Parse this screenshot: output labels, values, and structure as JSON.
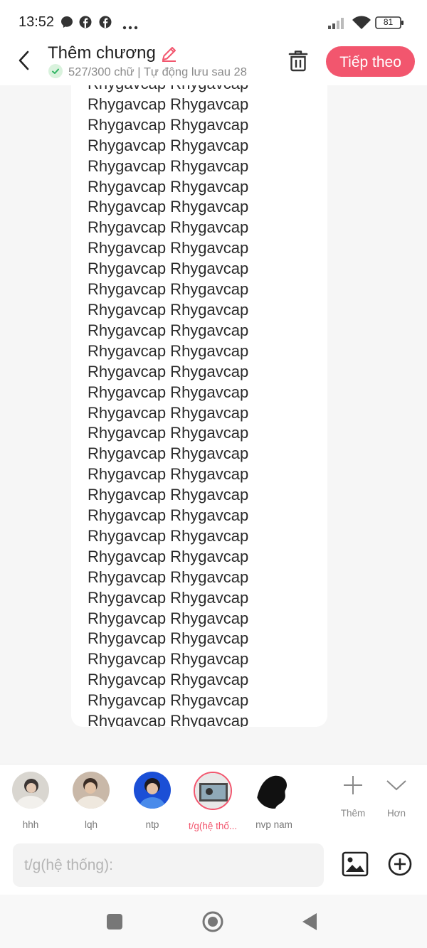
{
  "status_bar": {
    "time": "13:52",
    "battery": "81",
    "icons": [
      "messenger-icon",
      "facebook-icon",
      "facebook-icon",
      "more-dots-icon",
      "signal-icon",
      "wifi-icon",
      "battery-icon"
    ]
  },
  "header": {
    "title": "Thêm chương",
    "subtitle": "527/300 chữ | Tự động lưu sau 28",
    "next_label": "Tiếp theo",
    "accent": "#f2566e"
  },
  "editor": {
    "text": "Rhygavcap Rhygavcap\nRhygavcap Rhygavcap\nRhygavcap Rhygavcap\nRhygavcap Rhygavcap\nRhygavcap Rhygavcap\nRhygavcap Rhygavcap\nRhygavcap Rhygavcap\nRhygavcap Rhygavcap\nRhygavcap Rhygavcap\nRhygavcap Rhygavcap\nRhygavcap Rhygavcap\nRhygavcap Rhygavcap\nRhygavcap Rhygavcap\nRhygavcap Rhygavcap\nRhygavcap Rhygavcap\nRhygavcap Rhygavcap\nRhygavcap Rhygavcap\nRhygavcap Rhygavcap\nRhygavcap Rhygavcap\nRhygavcap Rhygavcap\nRhygavcap Rhygavcap\nRhygavcap Rhygavcap\nRhygavcap Rhygavcap\nRhygavcap Rhygavcap\nRhygavcap Rhygavcap\nRhygavcap Rhygavcap\nRhygavcap Rhygavcap\nRhygavcap Rhygavcap\nRhygavcap Rhygavcap\nRhygavcap Rhygavcap\nRhygavcap Rhygavcap\nRhygavcap Rhygavcap\nRhygavcap Rhygavcap\nRhygavcap"
  },
  "characters": [
    {
      "name": "hhh",
      "active": false
    },
    {
      "name": "lqh",
      "active": false
    },
    {
      "name": "ntp",
      "active": false
    },
    {
      "name": "t/g(hệ thố...",
      "active": true
    },
    {
      "name": "nvp nam",
      "active": false
    }
  ],
  "tools": {
    "add_label": "Thêm",
    "more_label": "Hơn"
  },
  "input": {
    "placeholder": "t/g(hệ thống):"
  }
}
